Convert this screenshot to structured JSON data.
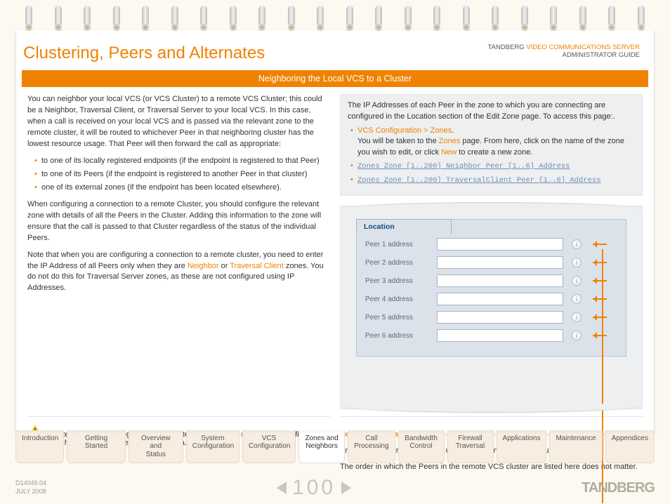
{
  "header": {
    "title": "Clustering, Peers and Alternates",
    "product_line1_a": "TANDBERG ",
    "product_line1_b": "VIDEO COMMUNICATIONS SERVER",
    "product_line2": "ADMINISTRATOR GUIDE"
  },
  "banner": "Neighboring the Local VCS to a Cluster",
  "left": {
    "p1": "You can neighbor your local VCS (or VCS Cluster) to a remote VCS Cluster; this could be a Neighbor, Traversal Client, or Traversal Server to your local VCS.  In this case, when a call is received on your local VCS and is passed via the relevant zone to the remote cluster, it will be routed to whichever Peer in that neighboring cluster has the lowest resource usage.  That Peer will then forward the call as appropriate:",
    "bul": [
      "to one of its locally registered endpoints (if the endpoint is registered to that Peer)",
      "to one of its Peers (if the endpoint is registered to another Peer in that cluster)",
      "one of its external zones (if the endpoint has been located elsewhere)."
    ],
    "p2": "When configuring a connection to a remote Cluster, you should configure the relevant zone with details of all the Peers in the Cluster.  Adding this information to the zone will ensure that the call is passed to that Cluster regardless of the status of the individual Peers.",
    "p3a": "Note that when you are configuring a connection to a remote cluster, you need to enter the IP Address of all Peers only when they are ",
    "p3b": "Neighbor",
    "p3c": " or ",
    "p3d": "Traversal Client",
    "p3e": " zones. You do not do this for Traversal Server zones, as these are not configured using IP Addresses."
  },
  "right": {
    "gp1": "The IP Addresses of each Peer in the zone to which you are connecting are configured in the Location section of the Edit Zone page.  To access this page:.",
    "link1": "VCS Configuration > Zones",
    "gp2a": "You will be taken to the ",
    "gp2b": "Zones",
    "gp2c": " page.  From here, click on the name of the zone you wish to edit, or click ",
    "gp2d": "New",
    "gp2e": " to create a new zone.",
    "mono1": "Zones Zone [1..200] Neighbor Peer [1..6] Address",
    "mono2": "Zones Zone [1..200] TraversalClient Peer [1..6] Address",
    "loc_tab": "Location",
    "fields": [
      "Peer 1 address",
      "Peer 2 address",
      "Peer 3 address",
      "Peer 4 address",
      "Peer 5 address",
      "Peer 6 address"
    ]
  },
  "warn": {
    "a": "Systems that are configured as Alternates (Peers) must ",
    "b": "not",
    "c": " also be configured as neighbors to each other, and vice versa."
  },
  "note": {
    "h": "Peer 1...Peer 6 address",
    "p1": "Enter the IP Address or FQDN of each Peer in the remote cluster.",
    "p2": "The order in which the Peers in the remote VCS cluster are listed here does not matter."
  },
  "tabs": {
    "g1": [
      "Introduction",
      "Getting Started",
      "Overview and\nStatus",
      "System\nConfiguration",
      "VCS\nConfiguration",
      "Zones and\nNeighbors"
    ],
    "g2": [
      "Call\nProcessing",
      "Bandwidth\nControl",
      "Firewall\nTraversal",
      "Applications",
      "Maintenance",
      "Appendices"
    ],
    "active": "Zones and\nNeighbors"
  },
  "footer": {
    "doc": "D14049.04",
    "date": "JULY 2008",
    "page": "100",
    "brand": "TANDBERG"
  }
}
